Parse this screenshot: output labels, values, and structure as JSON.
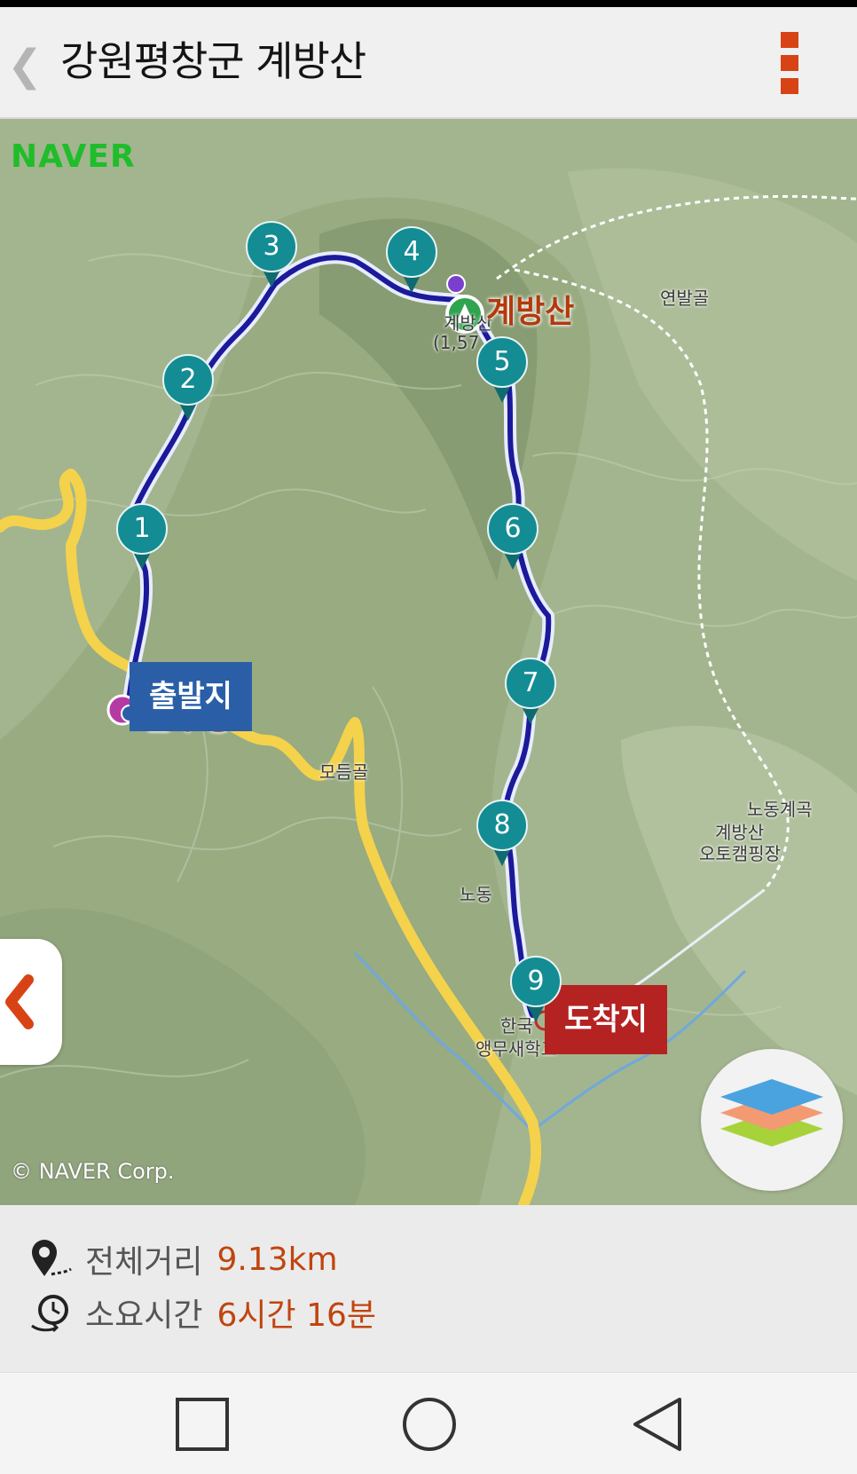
{
  "header": {
    "back_glyph": "❮",
    "title": "강원평창군 계방산",
    "more_icon": "more-vertical-icon"
  },
  "map": {
    "provider_logo": "NAVER",
    "copyright": "© NAVER Corp.",
    "peak_name": "계방산",
    "peak_sub": "계방산",
    "peak_elev": "(1,57",
    "start_place": "운두령",
    "start_tag": "출발지",
    "end_tag": "도착지",
    "places": [
      "연발골",
      "모듬골",
      "노동계곡",
      "계방산",
      "오토캠핑장",
      "노동",
      "한국",
      "앵무새학교"
    ],
    "waypoints": [
      "1",
      "2",
      "3",
      "4",
      "5",
      "6",
      "7",
      "8",
      "9"
    ],
    "colors": {
      "route": "#1a1a9a",
      "marker": "#148c94",
      "road": "#f5d24b",
      "start_tag": "#2a5fa8",
      "end_tag": "#b52222",
      "accent": "#d84315"
    }
  },
  "summary": {
    "distance_label": "전체거리",
    "distance_value": "9.13km",
    "time_label": "소요시간",
    "time_value": "6시간 16분"
  },
  "navbar": {
    "recents_icon": "square-icon",
    "home_icon": "circle-icon",
    "back_icon": "triangle-back-icon"
  }
}
